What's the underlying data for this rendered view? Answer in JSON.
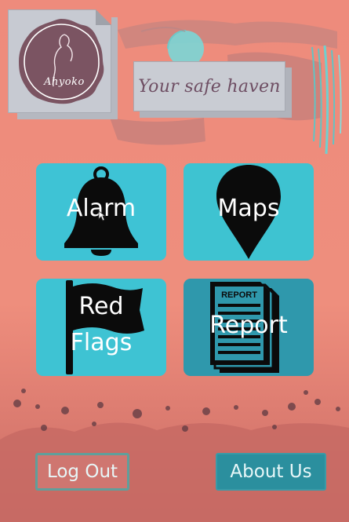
{
  "app": {
    "logo_text": "Ahyoko",
    "tagline": "Your safe haven"
  },
  "tiles": [
    {
      "id": "alarm",
      "label_lines": [
        "Alarm"
      ],
      "icon": "bell-icon"
    },
    {
      "id": "maps",
      "label_lines": [
        "Maps"
      ],
      "icon": "map-pin-icon"
    },
    {
      "id": "flags",
      "label_lines": [
        "Red",
        "Flags"
      ],
      "icon": "flag-icon"
    },
    {
      "id": "report",
      "label_lines": [
        "Report"
      ],
      "icon": "report-document-icon",
      "icon_text": "REPORT"
    }
  ],
  "buttons": {
    "logout": "Log Out",
    "about": "About Us"
  },
  "colors": {
    "background": "#ee8b7c",
    "tile_teal": "#3ec3d5",
    "tile_dark_teal": "#2f98ac",
    "icon": "#0b0b0b",
    "card_grey": "#c7cad2",
    "logo_circle": "#7b5462",
    "tagline_text": "#6e4e63"
  }
}
